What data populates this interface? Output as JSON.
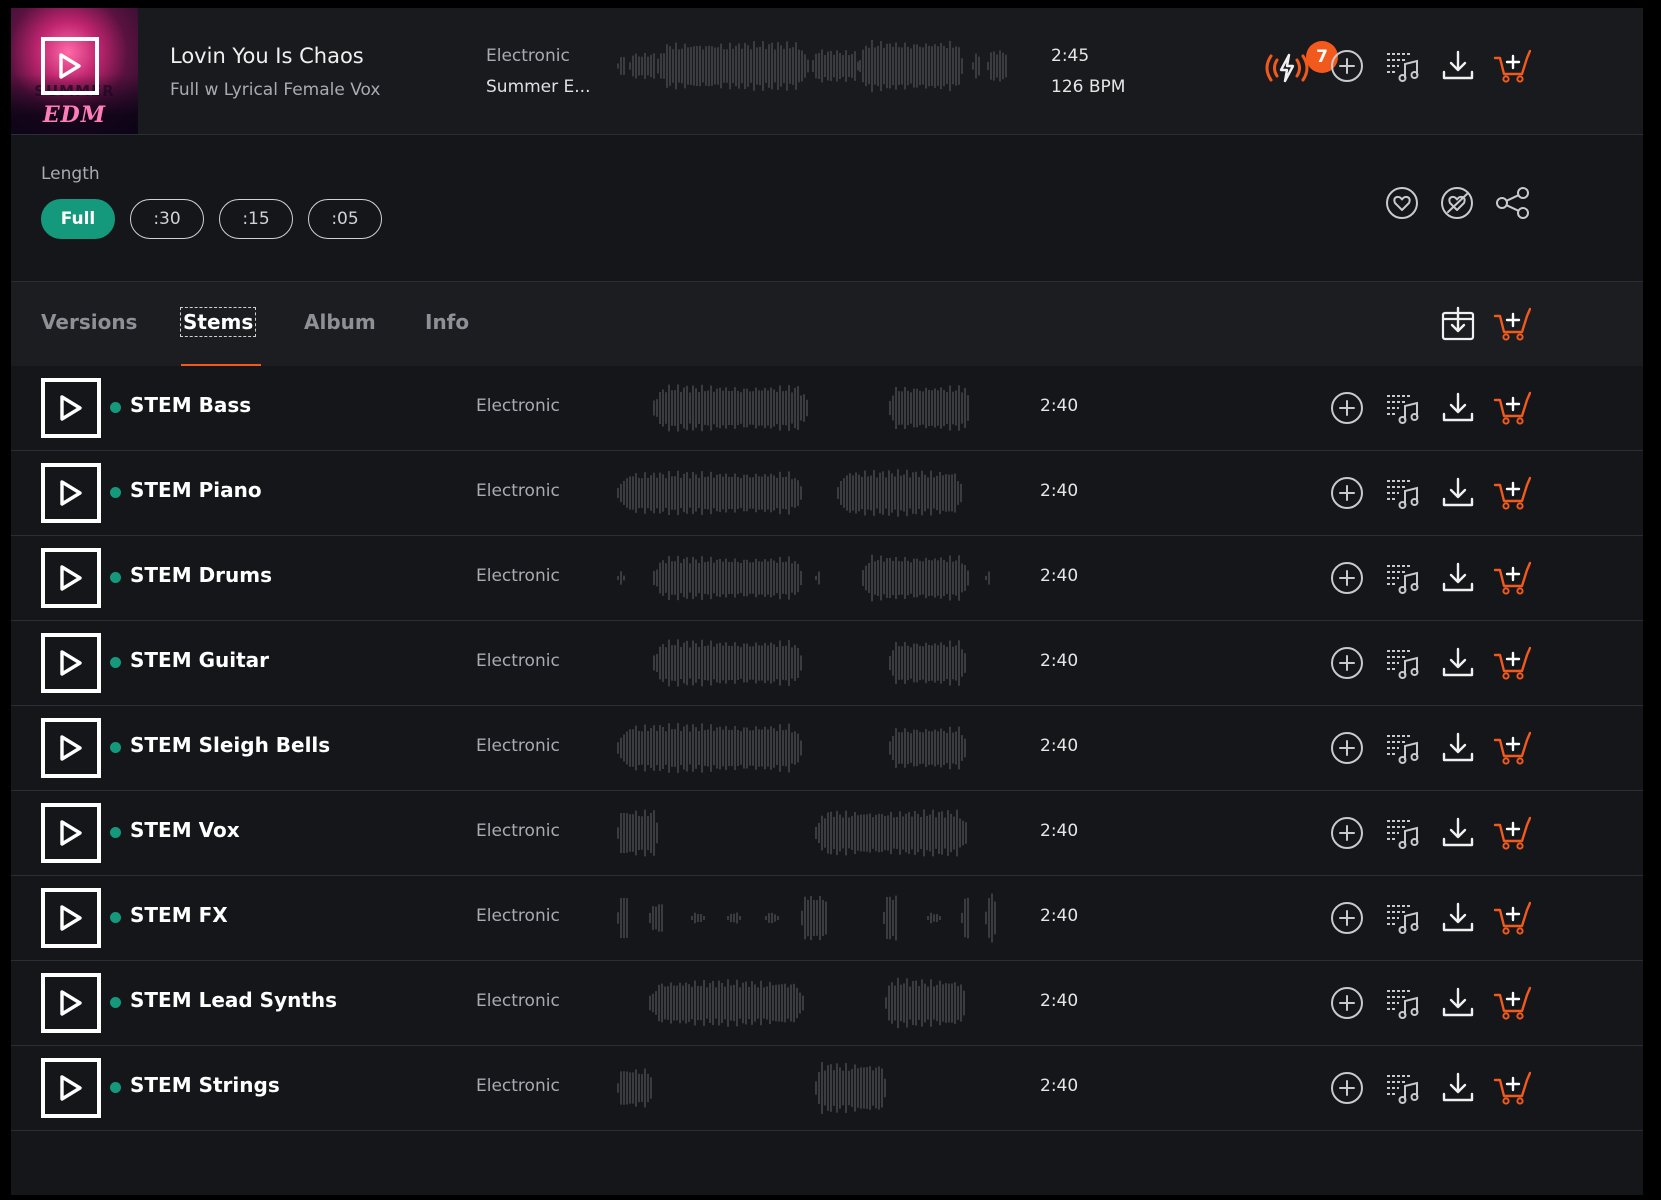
{
  "track": {
    "title": "Lovin You Is Chaos",
    "subtitle": "Full w Lyrical Female Vox",
    "genre": "Electronic",
    "album": "Summer E...",
    "duration": "2:45",
    "bpm": "126 BPM",
    "badge_count": "7",
    "cover_art_lettering": "EDM"
  },
  "length": {
    "label": "Length",
    "options": [
      "Full",
      ":30",
      ":15",
      ":05"
    ],
    "selected": "Full"
  },
  "tabs": {
    "items": [
      "Versions",
      "Stems",
      "Album",
      "Info"
    ],
    "selected": "Stems"
  },
  "stems": [
    {
      "name": "STEM Bass",
      "genre": "Electronic",
      "duration": "2:40"
    },
    {
      "name": "STEM Piano",
      "genre": "Electronic",
      "duration": "2:40"
    },
    {
      "name": "STEM Drums",
      "genre": "Electronic",
      "duration": "2:40"
    },
    {
      "name": "STEM Guitar",
      "genre": "Electronic",
      "duration": "2:40"
    },
    {
      "name": "STEM Sleigh Bells",
      "genre": "Electronic",
      "duration": "2:40"
    },
    {
      "name": "STEM Vox",
      "genre": "Electronic",
      "duration": "2:40"
    },
    {
      "name": "STEM FX",
      "genre": "Electronic",
      "duration": "2:40"
    },
    {
      "name": "STEM Lead Synths",
      "genre": "Electronic",
      "duration": "2:40"
    },
    {
      "name": "STEM Strings",
      "genre": "Electronic",
      "duration": "2:40"
    }
  ],
  "icons": {
    "play": "play-icon",
    "sync": "sync-lightning-icon",
    "add": "plus-circle-icon",
    "playlist": "playlist-music-icon",
    "download": "download-icon",
    "cart": "add-to-cart-icon",
    "favorite": "heart-circle-icon",
    "unfavorite": "heart-slash-icon",
    "share": "share-icon",
    "download_all": "download-box-icon"
  },
  "colors": {
    "accent_teal": "#14997c",
    "accent_orange": "#f25a1d",
    "background": "#14161a",
    "waveform": "#3a3c40"
  }
}
